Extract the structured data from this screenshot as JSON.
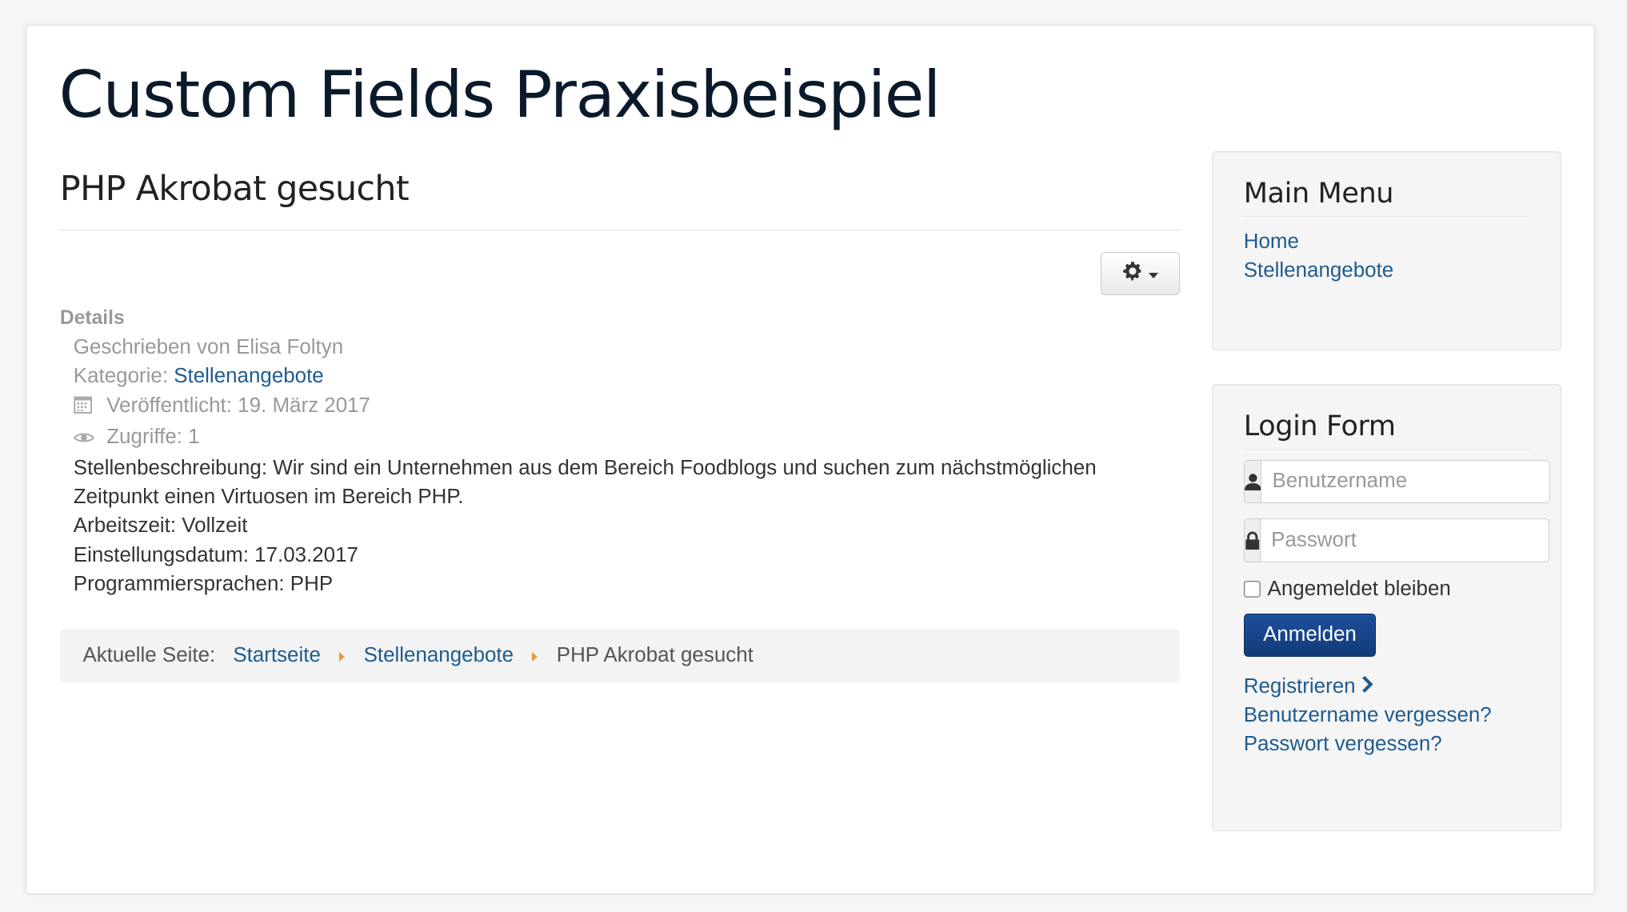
{
  "site": {
    "title": "Custom Fields Praxisbeispiel"
  },
  "article": {
    "title": "PHP Akrobat gesucht",
    "details_label": "Details",
    "author": "Geschrieben von Elisa Foltyn",
    "category_prefix": "Kategorie: ",
    "category": "Stellenangebote",
    "published": "Veröffentlicht: 19. März 2017",
    "hits": "Zugriffe: 1",
    "body": [
      "Stellenbeschreibung: Wir sind ein Unternehmen aus dem Bereich Foodblogs und suchen zum nächstmöglichen Zeitpunkt einen Virtuosen im Bereich PHP.",
      "Arbeitszeit: Vollzeit",
      "Einstellungsdatum: 17.03.2017",
      "Programmiersprachen: PHP"
    ]
  },
  "breadcrumb": {
    "label": "Aktuelle Seite:",
    "items": [
      "Startseite",
      "Stellenangebote",
      "PHP Akrobat gesucht"
    ],
    "separator_color": "#e79b3a"
  },
  "main_menu": {
    "title": "Main Menu",
    "items": [
      "Home",
      "Stellenangebote"
    ]
  },
  "login": {
    "title": "Login Form",
    "username_placeholder": "Benutzername",
    "password_placeholder": "Passwort",
    "remember_label": "Angemeldet bleiben",
    "submit_label": "Anmelden",
    "links": {
      "register": "Registrieren",
      "forgot_username": "Benutzername vergessen?",
      "forgot_password": "Passwort vergessen?"
    }
  },
  "colors": {
    "link": "#1f5b8e",
    "primary_button": "#1a4a94",
    "title": "#0b1a2a"
  },
  "icons": [
    "gear-icon",
    "caret-down-icon",
    "calendar-icon",
    "eye-icon",
    "user-icon",
    "lock-icon",
    "chevron-right-icon",
    "breadcrumb-arrow-icon"
  ]
}
